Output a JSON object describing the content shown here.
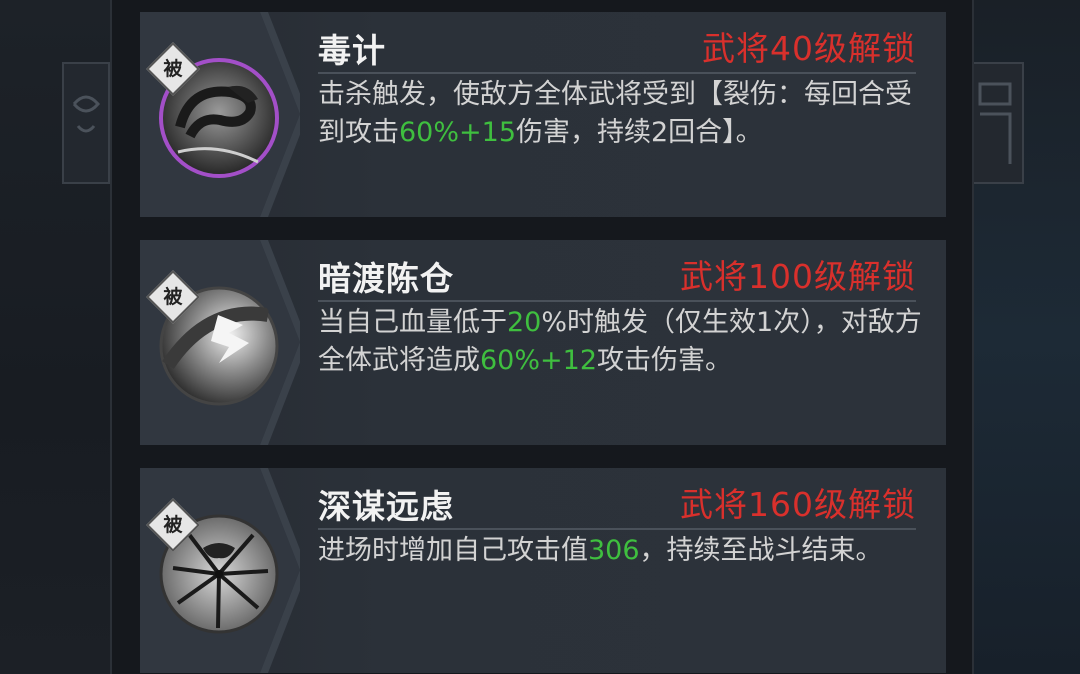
{
  "skills": [
    {
      "badge": "被",
      "title": "毒计",
      "unlock": "武将40级解锁",
      "icon": "snake-icon",
      "desc": [
        {
          "t": "击杀触发，使敌方全体武将受到【裂伤：每回合受到攻击"
        },
        {
          "t": "60%+15",
          "hl": true
        },
        {
          "t": "伤害，持续2回合】。"
        }
      ]
    },
    {
      "badge": "被",
      "title": "暗渡陈仓",
      "unlock": "武将100级解锁",
      "icon": "lightning-icon",
      "desc": [
        {
          "t": "当自己血量低于"
        },
        {
          "t": "20",
          "hl": true
        },
        {
          "t": "%时触发（仅生效1次），对敌方全体武将造成"
        },
        {
          "t": "60%+12",
          "hl": true
        },
        {
          "t": "攻击伤害。"
        }
      ]
    },
    {
      "badge": "被",
      "title": "深谋远虑",
      "unlock": "武将160级解锁",
      "icon": "cracked-orb-icon",
      "desc": [
        {
          "t": "进场时增加自己攻击值"
        },
        {
          "t": "306",
          "hl": true
        },
        {
          "t": "，持续至战斗结束。"
        }
      ]
    }
  ],
  "colors": {
    "unlock": "#d9302c",
    "highlight": "#3fbf3f",
    "purple_ring": "#a34fc8"
  }
}
